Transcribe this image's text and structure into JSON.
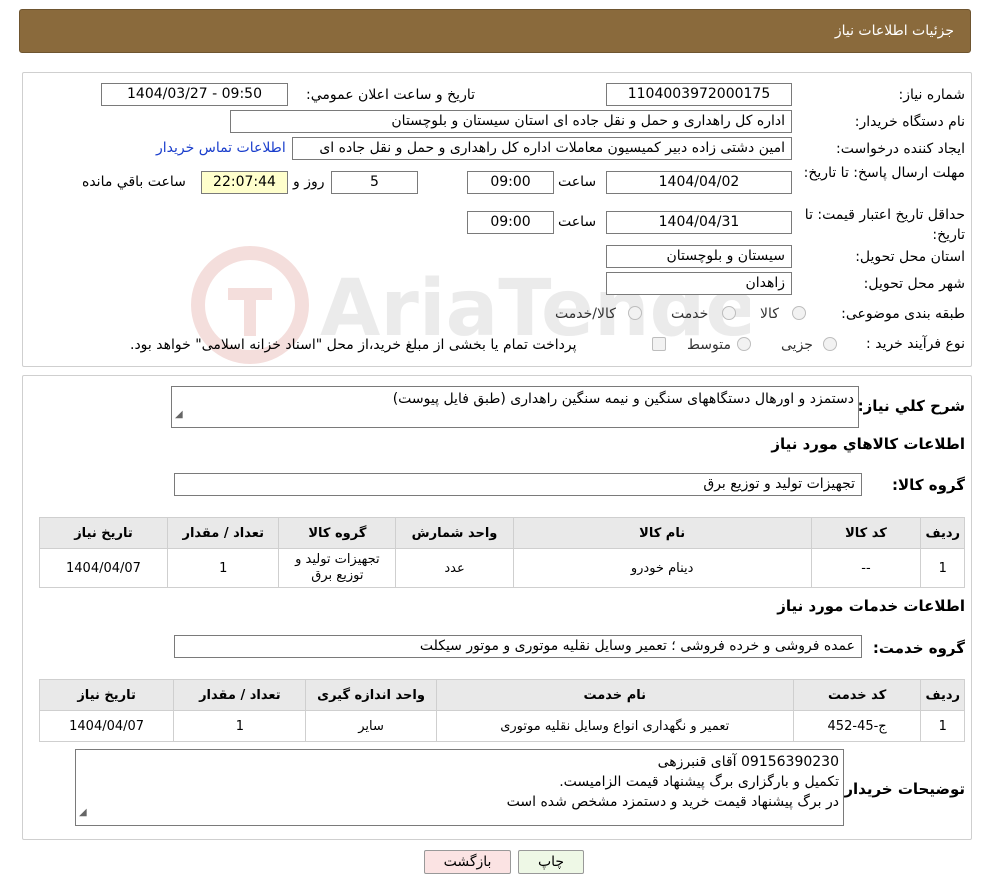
{
  "header": {
    "title": "جزئیات اطلاعات نیاز"
  },
  "labels": {
    "need_number": "شماره نیاز:",
    "announce_datetime": "تاریخ و ساعت اعلان عمومي:",
    "buyer_org": "نام دستگاه خريدار:",
    "requester": "ايجاد کننده درخواست:",
    "reply_deadline": "مهلت ارسال پاسخ: تا تاريخ:",
    "price_validity": "حداقل تاريخ اعتبار قيمت: تا تاريخ:",
    "time": "ساعت",
    "day_and": "روز و",
    "remaining": "ساعت باقي مانده",
    "delivery_province": "استان محل تحويل:",
    "delivery_city": "شهر محل تحويل:",
    "category": "طبقه بندی موضوعی:",
    "purchase_type": "نوع فرآيند خريد :"
  },
  "values": {
    "need_number": "1104003972000175",
    "announce_datetime": "1404/03/27 - 09:50",
    "buyer_org": "اداره کل راهداری و حمل و نقل جاده ای استان سیستان و بلوچستان",
    "requester": "امین دشتی زاده دبیر کمیسیون معاملات اداره کل راهداری و حمل و نقل جاده ای",
    "contact_link": "اطلاعات تماس خریدار",
    "reply_date": "1404/04/02",
    "reply_time": "09:00",
    "days": "5",
    "remaining_timer": "22:07:44",
    "validity_date": "1404/04/31",
    "validity_time": "09:00",
    "province": "سیستان و بلوچستان",
    "city": "زاهدان"
  },
  "category_options": [
    "کالا",
    "خدمت",
    "کالا/خدمت"
  ],
  "purchase_options": [
    "جزیی",
    "متوسط"
  ],
  "purchase_note": "پرداخت تمام یا بخشی از مبلغ خرید،از محل \"اسناد خزانه اسلامی\" خواهد بود.",
  "description": {
    "label": "شرح کلي نياز:",
    "text": "دستمزد و اورهال دستگاههای سنگین و نیمه سنگین راهداری (طبق فایل پیوست)"
  },
  "goods": {
    "section_title": "اطلاعات کالاهاي مورد نياز",
    "group_label": "گروه کالا:",
    "group_value": "تجهیزات تولید و توزیع برق",
    "headers": [
      "رديف",
      "کد کالا",
      "نام کالا",
      "واحد شمارش",
      "گروه کالا",
      "تعداد / مقدار",
      "تاريخ نياز"
    ],
    "rows": [
      {
        "row": "1",
        "code": "--",
        "name": "دینام خودرو",
        "unit": "عدد",
        "group": "تجهیزات تولید و توزیع برق",
        "qty": "1",
        "date": "1404/04/07"
      }
    ]
  },
  "services": {
    "section_title": "اطلاعات خدمات مورد نياز",
    "group_label": "گروه خدمت:",
    "group_value": "عمده فروشی و خرده فروشی ؛ تعمیر وسایل نقلیه موتوری و موتور سیکلت",
    "headers": [
      "رديف",
      "کد خدمت",
      "نام خدمت",
      "واحد اندازه گيری",
      "تعداد / مقدار",
      "تاريخ نياز"
    ],
    "rows": [
      {
        "row": "1",
        "code": "ج-45-452",
        "name": "تعمیر و نگهداری انواع وسایل نقلیه موتوری",
        "unit": "سایر",
        "qty": "1",
        "date": "1404/04/07"
      }
    ]
  },
  "buyer_notes": {
    "label": "توضيحات خريدار:",
    "lines": [
      "09156390230 آقای قنبرزهی",
      "تکمیل و بارگزاری برگ پیشنهاد قیمت الزامیست.",
      "در برگ پیشنهاد قیمت خرید و دستمزد مشخص شده است"
    ]
  },
  "buttons": {
    "print": "چاپ",
    "back": "بازگشت"
  },
  "watermark_text": "AriaTender.neT",
  "colors": {
    "header_bg": "#8a6a3c",
    "link": "#1a3ecc",
    "timer_bg": "#ffffcc"
  }
}
